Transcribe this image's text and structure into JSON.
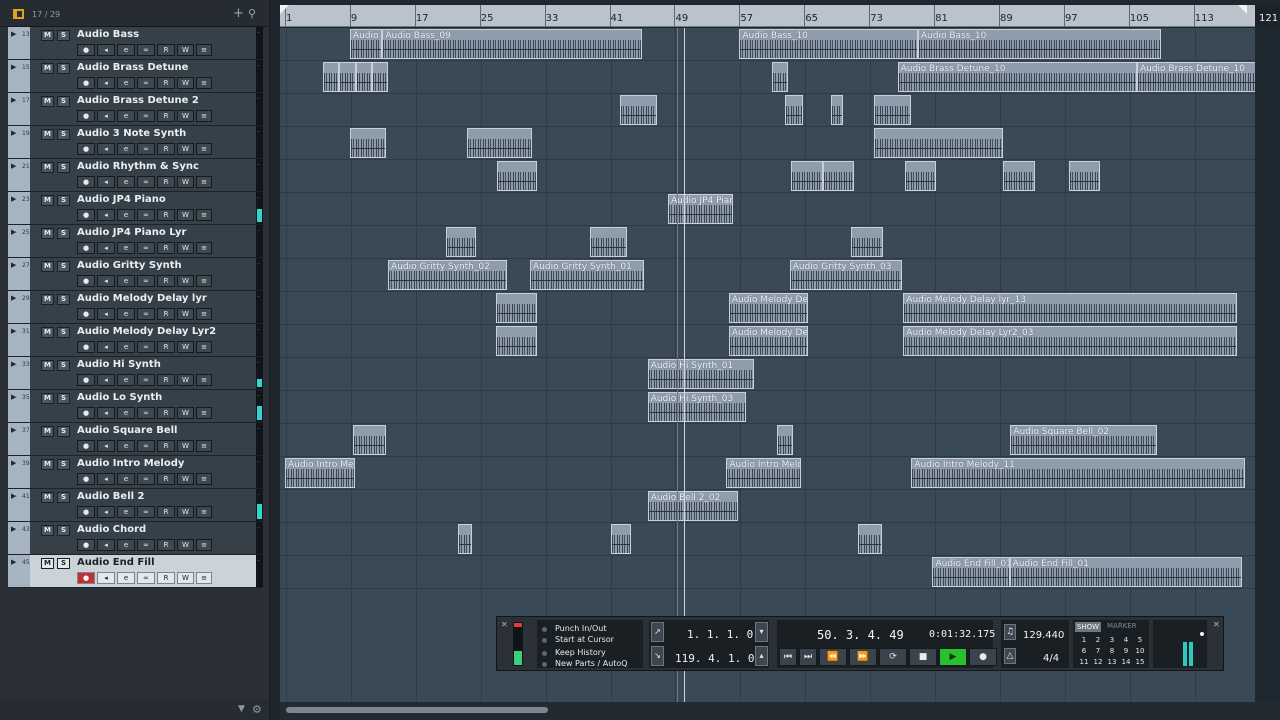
{
  "header": {
    "track_count": "17 / 29"
  },
  "ruler": {
    "bars": [
      "1",
      "9",
      "17",
      "25",
      "33",
      "41",
      "49",
      "57",
      "65",
      "73",
      "81",
      "89",
      "97",
      "105",
      "113"
    ],
    "end_bar": "121"
  },
  "tracks": [
    {
      "num": "13",
      "name": "Audio Bass",
      "meter": 0
    },
    {
      "num": "15",
      "name": "Audio Brass Detune",
      "meter": 0
    },
    {
      "num": "17",
      "name": "Audio Brass Detune 2",
      "meter": 0
    },
    {
      "num": "19",
      "name": "Audio 3 Note Synth",
      "meter": 0
    },
    {
      "num": "21",
      "name": "Audio Rhythm & Sync",
      "meter": 0
    },
    {
      "num": "23",
      "name": "Audio JP4 Piano",
      "meter": 0.45
    },
    {
      "num": "25",
      "name": "Audio JP4 Piano Lyr",
      "meter": 0
    },
    {
      "num": "27",
      "name": "Audio Gritty Synth",
      "meter": 0
    },
    {
      "num": "29",
      "name": "Audio Melody Delay lyr",
      "meter": 0
    },
    {
      "num": "31",
      "name": "Audio Melody Delay Lyr2",
      "meter": 0
    },
    {
      "num": "33",
      "name": "Audio Hi Synth",
      "meter": 0.3
    },
    {
      "num": "35",
      "name": "Audio Lo Synth",
      "meter": 0.5
    },
    {
      "num": "37",
      "name": "Audio Square Bell",
      "meter": 0
    },
    {
      "num": "39",
      "name": "Audio Intro Melody",
      "meter": 0
    },
    {
      "num": "41",
      "name": "Audio Bell 2",
      "meter": 0.55
    },
    {
      "num": "43",
      "name": "Audio Chord",
      "meter": 0
    },
    {
      "num": "45",
      "name": "Audio End Fill",
      "meter": 0,
      "selected": true
    }
  ],
  "track_buttons": {
    "mute": "M",
    "solo": "S",
    "read": "R",
    "write": "W"
  },
  "events": [
    {
      "track": 0,
      "start": 9,
      "end": 13,
      "label": "Audio E"
    },
    {
      "track": 0,
      "start": 13,
      "end": 45,
      "label": "Audio Bass_09"
    },
    {
      "track": 0,
      "start": 57,
      "end": 79,
      "label": "Audio Bass_10"
    },
    {
      "track": 0,
      "start": 79,
      "end": 109,
      "label": "Audio Bass_10"
    },
    {
      "track": 1,
      "start": 5.7,
      "end": 7.7,
      "label": ""
    },
    {
      "track": 1,
      "start": 7.7,
      "end": 9.7,
      "label": ""
    },
    {
      "track": 1,
      "start": 9.7,
      "end": 11.7,
      "label": ""
    },
    {
      "track": 1,
      "start": 11.7,
      "end": 13.7,
      "label": ""
    },
    {
      "track": 1,
      "start": 61,
      "end": 63,
      "label": ""
    },
    {
      "track": 1,
      "start": 76.5,
      "end": 106,
      "label": "Audio Brass Detune_10"
    },
    {
      "track": 1,
      "start": 106,
      "end": 122.5,
      "label": "Audio Brass Detune_10"
    },
    {
      "track": 2,
      "start": 42.3,
      "end": 46.8,
      "label": ""
    },
    {
      "track": 2,
      "start": 62.6,
      "end": 64.9,
      "label": ""
    },
    {
      "track": 2,
      "start": 68.3,
      "end": 69.8,
      "label": ""
    },
    {
      "track": 2,
      "start": 73.6,
      "end": 78.1,
      "label": ""
    },
    {
      "track": 3,
      "start": 9,
      "end": 13.5,
      "label": ""
    },
    {
      "track": 3,
      "start": 23.4,
      "end": 31.4,
      "label": ""
    },
    {
      "track": 3,
      "start": 73.6,
      "end": 89.5,
      "label": ""
    },
    {
      "track": 4,
      "start": 27.1,
      "end": 32,
      "label": ""
    },
    {
      "track": 4,
      "start": 63.4,
      "end": 67.3,
      "label": ""
    },
    {
      "track": 4,
      "start": 67.3,
      "end": 71.1,
      "label": ""
    },
    {
      "track": 4,
      "start": 77.4,
      "end": 81.2,
      "label": ""
    },
    {
      "track": 4,
      "start": 89.5,
      "end": 93.4,
      "label": ""
    },
    {
      "track": 4,
      "start": 97.6,
      "end": 101.4,
      "label": ""
    },
    {
      "track": 5,
      "start": 48.2,
      "end": 56.2,
      "label": "Audio JP4 Piar"
    },
    {
      "track": 6,
      "start": 20.8,
      "end": 24.6,
      "label": ""
    },
    {
      "track": 6,
      "start": 38.6,
      "end": 43.1,
      "label": ""
    },
    {
      "track": 6,
      "start": 70.8,
      "end": 74.7,
      "label": ""
    },
    {
      "track": 7,
      "start": 13.7,
      "end": 28.3,
      "label": "Audio Gritty Synth_02"
    },
    {
      "track": 7,
      "start": 31.2,
      "end": 45.3,
      "label": "Audio Gritty Synth_01"
    },
    {
      "track": 7,
      "start": 63.2,
      "end": 77.1,
      "label": "Audio Gritty Synth_03"
    },
    {
      "track": 8,
      "start": 27,
      "end": 32,
      "label": ""
    },
    {
      "track": 8,
      "start": 55.7,
      "end": 65.5,
      "label": "Audio Melody Del"
    },
    {
      "track": 8,
      "start": 77.2,
      "end": 118.3,
      "label": "Audio Melody Delay lyr_13"
    },
    {
      "track": 9,
      "start": 27,
      "end": 32,
      "label": ""
    },
    {
      "track": 9,
      "start": 55.7,
      "end": 65.5,
      "label": "Audio Melody Del"
    },
    {
      "track": 9,
      "start": 77.2,
      "end": 118.3,
      "label": "Audio Melody Delay Lyr2_03"
    },
    {
      "track": 10,
      "start": 45.7,
      "end": 58.8,
      "label": "Audio Hi Synth_01"
    },
    {
      "track": 11,
      "start": 45.7,
      "end": 57.8,
      "label": "Audio Hi Synth_03"
    },
    {
      "track": 12,
      "start": 9.4,
      "end": 13.4,
      "label": ""
    },
    {
      "track": 12,
      "start": 61.6,
      "end": 63.6,
      "label": ""
    },
    {
      "track": 12,
      "start": 90.4,
      "end": 108.5,
      "label": "Audio Square Bell_02"
    },
    {
      "track": 13,
      "start": 1,
      "end": 9.6,
      "label": "Audio Intro Mel"
    },
    {
      "track": 13,
      "start": 55.4,
      "end": 64.6,
      "label": "Audio Intro Melo"
    },
    {
      "track": 13,
      "start": 78.2,
      "end": 119.3,
      "label": "Audio Intro Melody_11"
    },
    {
      "track": 14,
      "start": 45.7,
      "end": 56.8,
      "label": "Audio Bell 2_02"
    },
    {
      "track": 15,
      "start": 22.3,
      "end": 24,
      "label": ""
    },
    {
      "track": 15,
      "start": 41.2,
      "end": 43.6,
      "label": ""
    },
    {
      "track": 15,
      "start": 71.6,
      "end": 74.6,
      "label": ""
    },
    {
      "track": 16,
      "start": 80.8,
      "end": 90.3,
      "label": "Audio End Fill_01"
    },
    {
      "track": 16,
      "start": 90.3,
      "end": 119,
      "label": "Audio End Fill_01"
    }
  ],
  "transport": {
    "options": [
      "Punch In/Out",
      "Start at Cursor",
      "Keep History",
      "New Parts / AutoQ"
    ],
    "left_locator": "1. 1. 1.   0",
    "right_locator": "119. 4. 1.   0",
    "position_bars": "50. 3. 4. 49",
    "position_time": "0:01:32.175",
    "tempo": "129.440",
    "signature": "4/4",
    "show_label": "SHOW",
    "marker_label": "MARKER",
    "marker_numbers": [
      "1",
      "2",
      "3",
      "4",
      "5",
      "6",
      "7",
      "8",
      "9",
      "10",
      "11",
      "12",
      "13",
      "14",
      "15"
    ]
  }
}
